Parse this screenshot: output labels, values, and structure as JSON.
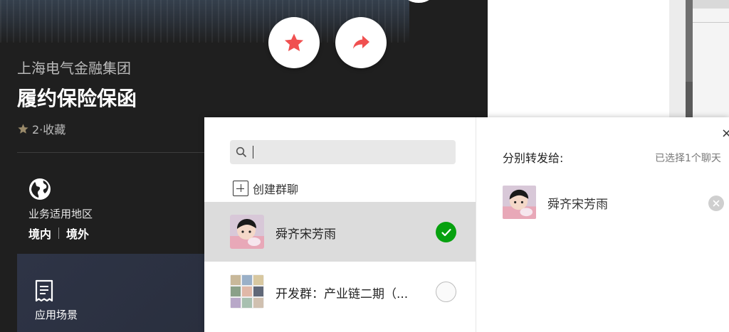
{
  "product": {
    "company": "上海电气金融集团",
    "title": "履约保险保函",
    "favorites": "2·收藏",
    "region_label": "业务适用地区",
    "region_domestic": "境内",
    "region_overseas": "境外",
    "scene_label": "应用场景"
  },
  "actions": {
    "star_icon": "star-icon",
    "share_icon": "share-icon"
  },
  "dialog": {
    "search": {
      "value": "",
      "placeholder": ""
    },
    "create_group_label": "创建群聊",
    "contacts": [
      {
        "name": "舜齐宋芳雨",
        "selected": true
      },
      {
        "name": "开发群：产业链二期（...",
        "selected": false
      }
    ],
    "send_to_label": "分别转发给:",
    "selected_count_text": "已选择1个聊天",
    "selected_items": [
      {
        "name": "舜齐宋芳雨"
      }
    ],
    "close_label": "×"
  },
  "colors": {
    "accent_red": "#f05050",
    "check_green": "#07a10f"
  }
}
